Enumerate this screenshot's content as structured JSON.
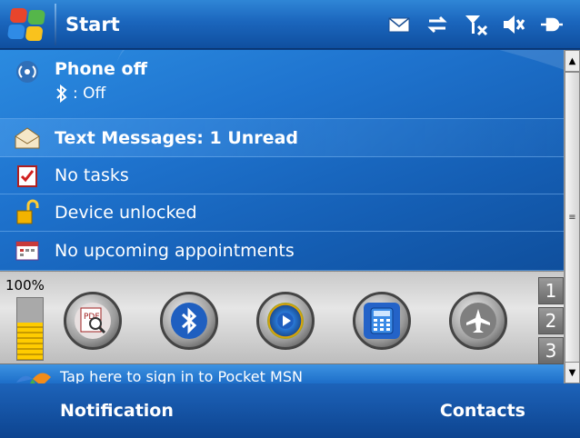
{
  "top_bar": {
    "title": "Start",
    "status_icons": [
      "envelope-icon",
      "sync-arrows-icon",
      "signal-off-icon",
      "speaker-off-icon",
      "connection-icon"
    ]
  },
  "today": {
    "phone": {
      "title": "Phone off",
      "bluetooth_status": ": Off"
    },
    "messages": "Text Messages: 1 Unread",
    "tasks": "No tasks",
    "lock": "Device unlocked",
    "appointments": "No upcoming appointments"
  },
  "launcher": {
    "battery_label": "100%",
    "battery_level": 1.0,
    "apps": [
      "pdf-viewer-icon",
      "bluetooth-icon",
      "media-player-icon",
      "calculator-icon",
      "airplane-mode-icon"
    ],
    "pages": [
      "1",
      "2",
      "3"
    ]
  },
  "msn": {
    "text": "Tap here to sign in to Pocket MSN"
  },
  "softkeys": {
    "left": "Notification",
    "right": "Contacts"
  },
  "colors": {
    "accent": "#1b66bd",
    "text": "#ffffff"
  }
}
